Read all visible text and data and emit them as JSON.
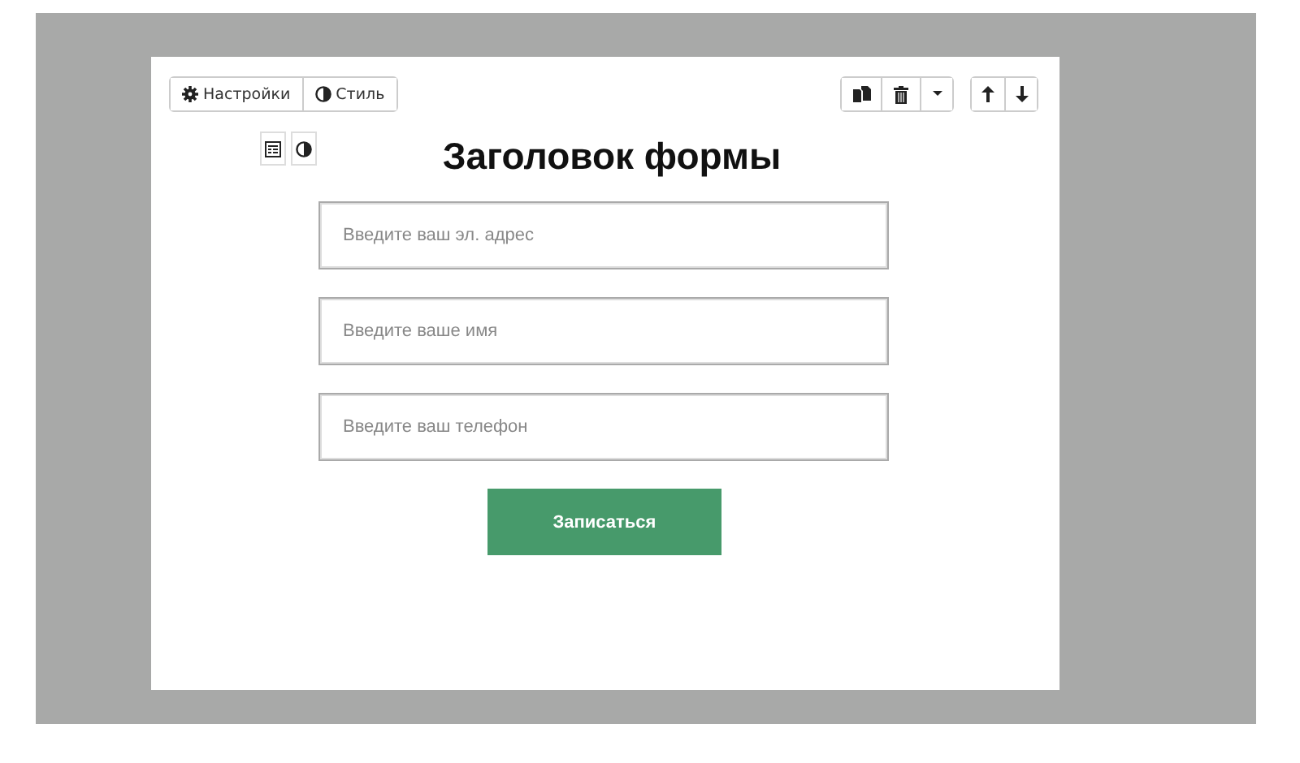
{
  "toolbar": {
    "buttons": [
      {
        "label": "Настройки"
      },
      {
        "label": "Стиль"
      }
    ]
  },
  "form": {
    "title": "Заголовок формы",
    "fields": [
      {
        "placeholder": "Введите ваш эл. адрес"
      },
      {
        "placeholder": "Введите ваше имя"
      },
      {
        "placeholder": "Введите ваш телефон"
      }
    ],
    "submit": "Записаться"
  }
}
